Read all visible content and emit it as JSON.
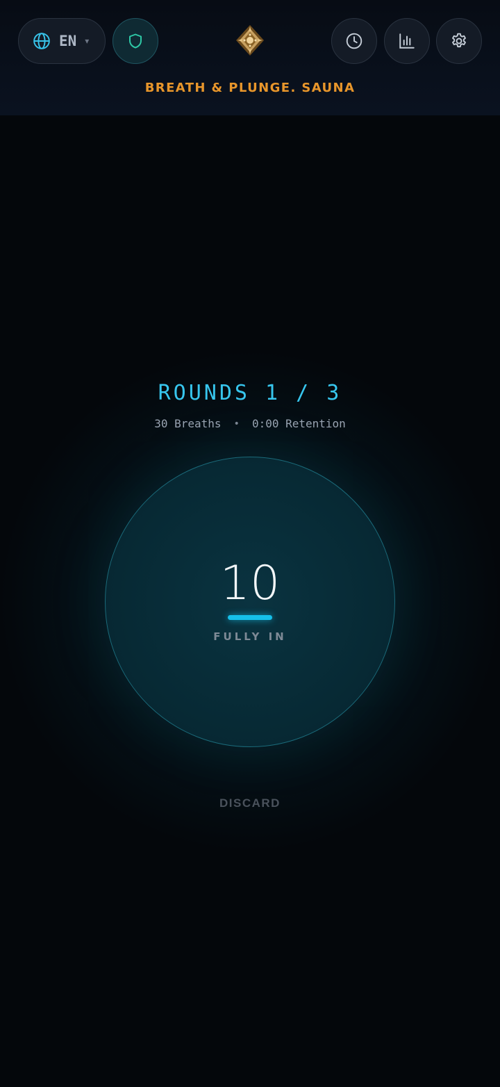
{
  "header": {
    "language": {
      "code": "EN",
      "icon": "globe-icon",
      "caret": "▾"
    },
    "shield_icon": "shield-icon",
    "logo_icon": "ornament-logo",
    "buttons": [
      {
        "name": "history",
        "icon": "clock-icon"
      },
      {
        "name": "stats",
        "icon": "bar-chart-icon"
      },
      {
        "name": "settings",
        "icon": "gear-icon"
      }
    ],
    "brand": "BREATH & PLUNGE. SAUNA"
  },
  "session": {
    "rounds_label": "ROUNDS 1 / 3",
    "breaths_label": "30 Breaths",
    "separator": "•",
    "retention_label": "0:00 Retention",
    "count": "10",
    "phase": "FULLY IN",
    "discard_label": "DISCARD"
  },
  "colors": {
    "accent": "#37c6ee",
    "brand": "#e8962b",
    "shield": "#2ec8a6",
    "background": "#04070b"
  }
}
